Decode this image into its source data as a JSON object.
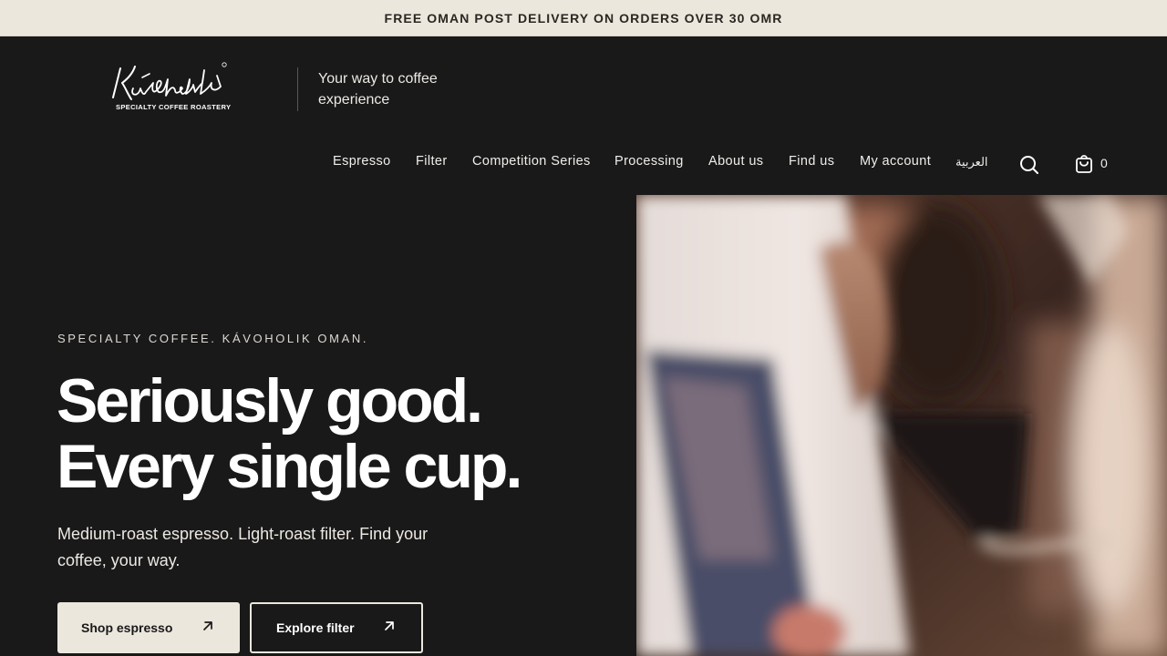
{
  "announcement": {
    "text": "FREE OMAN POST DELIVERY ON ORDERS OVER 30 OMR"
  },
  "header": {
    "logo_text": "Kávoholik",
    "logo_subtext": "SPECIALTY COFFEE ROASTERY",
    "tagline": "Your way to coffee experience"
  },
  "nav": {
    "items": [
      {
        "label": "Espresso"
      },
      {
        "label": "Filter"
      },
      {
        "label": "Competition Series"
      },
      {
        "label": "Processing"
      },
      {
        "label": "About us"
      },
      {
        "label": "Find us"
      },
      {
        "label": "My account"
      },
      {
        "label": "العربية"
      }
    ],
    "search_icon": "search-icon",
    "cart_icon": "cart-icon",
    "cart_count": "0"
  },
  "hero": {
    "eyebrow": "SPECIALTY COFFEE. KÁVOHOLIK OMAN.",
    "headline_line1": "Seriously good.",
    "headline_line2": "Every single cup.",
    "subhead": "Medium-roast espresso. Light-roast filter. Find your coffee, your way.",
    "primary_button": "Shop espresso",
    "secondary_button": "Explore filter",
    "arrow_icon": "arrow-up-right-icon"
  },
  "colors": {
    "background": "#1a1919",
    "announcement_bg": "#ebe7dc",
    "button_light": "#ebe7dc",
    "text": "#ffffff"
  }
}
